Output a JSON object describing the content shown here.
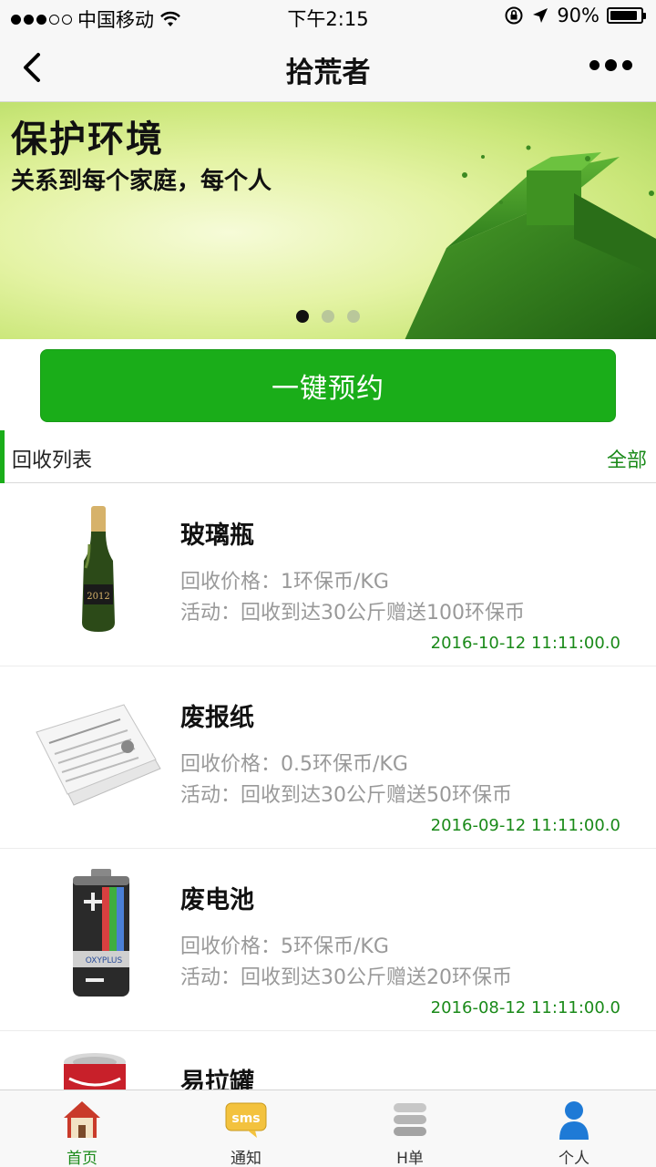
{
  "status_bar": {
    "carrier": "中国移动",
    "time": "下午2:15",
    "battery": "90%",
    "battery_level": 0.9
  },
  "nav": {
    "title": "拾荒者"
  },
  "banner": {
    "title": "保护环境",
    "subtitle": "关系到每个家庭，每个人",
    "slide_count": 3,
    "active_slide": 0
  },
  "book_button": {
    "label": "一键预约"
  },
  "section": {
    "title": "回收列表",
    "all_label": "全部"
  },
  "items": [
    {
      "name": "玻璃瓶",
      "price": "回收价格：1环保币/KG",
      "activity": "活动：回收到达30公斤赠送100环保币",
      "date": "2016-10-12 11:11:00.0",
      "icon": "champagne-bottle-icon"
    },
    {
      "name": "废报纸",
      "price": "回收价格：0.5环保币/KG",
      "activity": "活动：回收到达30公斤赠送50环保币",
      "date": "2016-09-12 11:11:00.0",
      "icon": "newspaper-icon"
    },
    {
      "name": "废电池",
      "price": "回收价格：5环保币/KG",
      "activity": "活动：回收到达30公斤赠送20环保币",
      "date": "2016-08-12 11:11:00.0",
      "icon": "battery-icon"
    },
    {
      "name": "易拉罐",
      "price": "",
      "activity": "",
      "date": "",
      "icon": "soda-can-icon"
    }
  ],
  "tabs": [
    {
      "label": "首页",
      "icon": "home-icon",
      "active": true
    },
    {
      "label": "通知",
      "icon": "sms-icon",
      "active": false
    },
    {
      "label": "H单",
      "icon": "stack-icon",
      "active": false
    },
    {
      "label": "个人",
      "icon": "person-icon",
      "active": false
    }
  ],
  "colors": {
    "accent": "#1aad19",
    "accent_text": "#1a8a19",
    "muted_text": "#999999"
  }
}
